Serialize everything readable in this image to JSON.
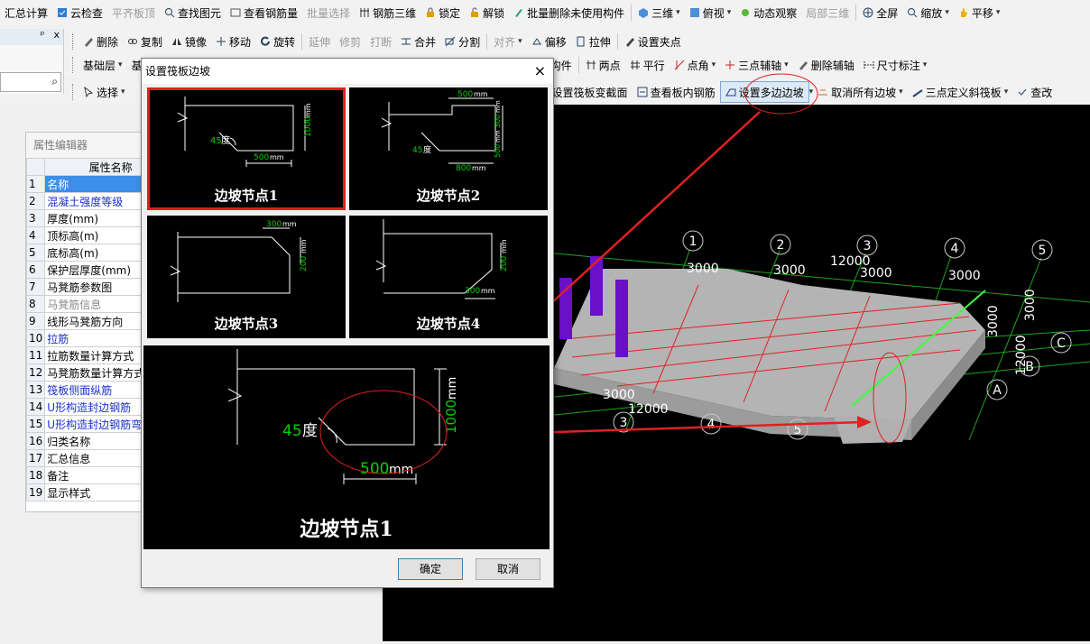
{
  "toolbar1": [
    "汇总计算",
    "云检查",
    "平齐板顶",
    "查找图元",
    "查看钢筋量",
    "批量选择",
    "钢筋三维",
    "锁定",
    "解锁",
    "批量删除未使用构件",
    "三维",
    "俯视",
    "动态观察",
    "局部三维",
    "全屏",
    "缩放",
    "平移"
  ],
  "toolbar2": [
    "删除",
    "复制",
    "镜像",
    "移动",
    "旋转",
    "延伸",
    "修剪",
    "打断",
    "合并",
    "分割",
    "对齐",
    "偏移",
    "拉伸",
    "设置夹点"
  ],
  "toolbar3": {
    "floor": "基础层",
    "floor2": "基",
    "items": [
      "构件",
      "两点",
      "平行",
      "点角",
      "三点辅轴",
      "删除辅轴",
      "尺寸标注"
    ]
  },
  "toolbar4": {
    "select": "选择",
    "items": [
      "设置筏板变截面",
      "查看板内钢筋",
      "设置多边边坡",
      "取消所有边坡",
      "三点定义斜筏板",
      "查改"
    ]
  },
  "left_panel": {
    "pin": "ᵖ",
    "close": "x"
  },
  "prop_editor": {
    "title": "属性编辑器",
    "header": "属性名称",
    "rows": [
      {
        "n": "1",
        "name": "名称",
        "style": "sel"
      },
      {
        "n": "2",
        "name": "混凝土强度等级",
        "style": "blue"
      },
      {
        "n": "3",
        "name": "厚度(mm)",
        "style": ""
      },
      {
        "n": "4",
        "name": "顶标高(m)",
        "style": ""
      },
      {
        "n": "5",
        "name": "底标高(m)",
        "style": ""
      },
      {
        "n": "6",
        "name": "保护层厚度(mm)",
        "style": ""
      },
      {
        "n": "7",
        "name": "马凳筋参数图",
        "style": ""
      },
      {
        "n": "8",
        "name": "马凳筋信息",
        "style": "grey"
      },
      {
        "n": "9",
        "name": "线形马凳筋方向",
        "style": ""
      },
      {
        "n": "10",
        "name": "拉筋",
        "style": "blue"
      },
      {
        "n": "11",
        "name": "拉筋数量计算方式",
        "style": ""
      },
      {
        "n": "12",
        "name": "马凳筋数量计算方式",
        "style": ""
      },
      {
        "n": "13",
        "name": "筏板侧面纵筋",
        "style": "blue"
      },
      {
        "n": "14",
        "name": "U形构造封边钢筋",
        "style": "blue"
      },
      {
        "n": "15",
        "name": "U形构造封边钢筋弯折长度",
        "style": "blue"
      },
      {
        "n": "16",
        "name": "归类名称",
        "style": ""
      },
      {
        "n": "17",
        "name": "汇总信息",
        "style": ""
      },
      {
        "n": "18",
        "name": "备注",
        "style": ""
      },
      {
        "n": "19",
        "name": "显示样式",
        "style": ""
      }
    ]
  },
  "dialog": {
    "title": "设置筏板边坡",
    "close": "×",
    "nodes": [
      {
        "caption": "边坡节点1",
        "angle": "45",
        "angle_unit": "度",
        "dims": [
          "1000",
          "mm",
          "500",
          "mm"
        ]
      },
      {
        "caption": "边坡节点2",
        "angle": "45",
        "angle_unit": "度",
        "dims": [
          "500",
          "mm",
          "300",
          "mm",
          "500",
          "mm",
          "800",
          "mm"
        ]
      },
      {
        "caption": "边坡节点3",
        "dims": [
          "300",
          "mm",
          "200",
          "mm"
        ]
      },
      {
        "caption": "边坡节点4",
        "dims": [
          "200",
          "mm",
          "300",
          "mm"
        ]
      }
    ],
    "preview": {
      "caption": "边坡节点1",
      "angle": "45",
      "angle_unit": "度",
      "dim_h": "1000",
      "dim_h_unit": "mm",
      "dim_w": "500",
      "dim_w_unit": "mm"
    },
    "ok": "确定",
    "cancel": "取消"
  },
  "viewport": {
    "axis_numbers": [
      "1",
      "2",
      "3",
      "4",
      "5"
    ],
    "axis_numbers_front": [
      "3",
      "4",
      "5"
    ],
    "axis_letters": [
      "A",
      "B",
      "C"
    ],
    "dims_top": [
      "3000",
      "3000",
      "12000",
      "3000",
      "3000"
    ],
    "dims_right": [
      "3000",
      "3000",
      "12000"
    ],
    "dims_front": [
      "3000",
      "12000"
    ]
  },
  "colors": {
    "accent": "#e02020",
    "viewport_bg": "#000000",
    "green_text": "#00d000",
    "slab": "#b4b4b4"
  }
}
